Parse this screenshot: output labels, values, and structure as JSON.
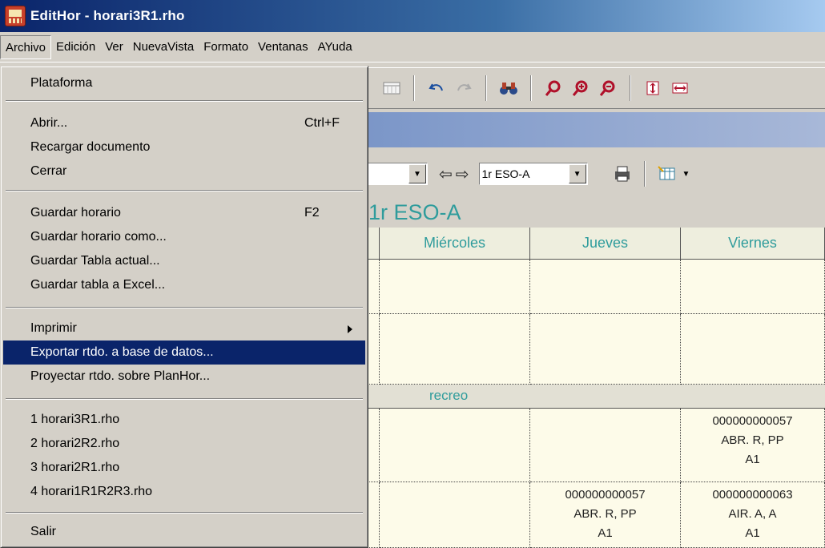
{
  "window": {
    "title": "EditHor - horari3R1.rho"
  },
  "menubar": [
    "Archivo",
    "Edición",
    "Ver",
    "NuevaVista",
    "Formato",
    "Ventanas",
    "AYuda"
  ],
  "file_menu": {
    "plataforma": "Plataforma",
    "abrir": "Abrir...",
    "abrir_shortcut": "Ctrl+F",
    "recargar": "Recargar documento",
    "cerrar": "Cerrar",
    "guardar": "Guardar horario",
    "guardar_shortcut": "F2",
    "guardar_como": "Guardar horario como...",
    "guardar_tabla": "Guardar Tabla actual...",
    "guardar_excel": "Guardar tabla a Excel...",
    "imprimir": "Imprimir",
    "exportar": "Exportar rtdo. a base de datos...",
    "proyectar": "Proyectar rtdo. sobre PlanHor...",
    "recent1": "1 horari3R1.rho",
    "recent2": "2 horari2R2.rho",
    "recent3": "3 horari2R1.rho",
    "recent4": "4 horari1R1R2R3.rho",
    "salir": "Salir"
  },
  "toolbar2": {
    "group_value": "1r ESO-A"
  },
  "schedule": {
    "title": "1r ESO-A",
    "columns": [
      "Miércoles",
      "Jueves",
      "Viernes"
    ],
    "recreo": "recreo",
    "cells": {
      "r3_viernes": [
        "000000000057",
        "ABR. R, PP",
        "A1"
      ],
      "r4_jueves": [
        "000000000057",
        "ABR. R, PP",
        "A1"
      ],
      "r4_viernes": [
        "000000000063",
        "AIR. A, A",
        "A1"
      ]
    }
  },
  "icons": [
    "app-icon",
    "calendar-icon",
    "undo-icon",
    "redo-icon",
    "binoculars-icon",
    "zoom-icon",
    "zoom-in-icon",
    "zoom-out-icon",
    "row-height-icon",
    "column-width-icon",
    "print-icon",
    "table-icon"
  ],
  "colors": {
    "title_bar": "#0a246a",
    "selection": "#0a246a",
    "schedule_text": "#2f9c9c",
    "grid_bg": "#fdfbe9"
  }
}
